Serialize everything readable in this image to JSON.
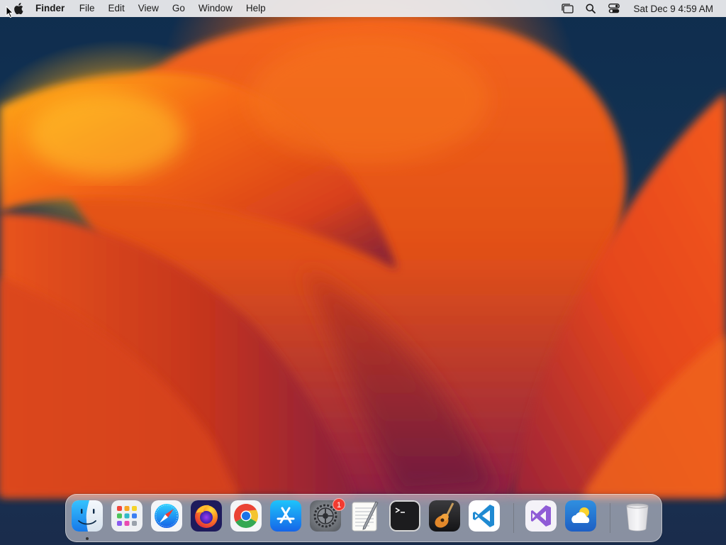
{
  "menubar": {
    "apple_icon": "apple-logo-icon",
    "app_name": "Finder",
    "menus": [
      "File",
      "Edit",
      "View",
      "Go",
      "Window",
      "Help"
    ],
    "status_icons": [
      "stage-manager-icon",
      "spotlight-search-icon",
      "control-center-icon"
    ],
    "clock": "Sat Dec 9  4:59 AM"
  },
  "dock": {
    "apps": [
      {
        "name": "Finder",
        "icon": "finder-icon",
        "running": true
      },
      {
        "name": "Launchpad",
        "icon": "launchpad-icon"
      },
      {
        "name": "Safari",
        "icon": "safari-icon"
      },
      {
        "name": "Firefox",
        "icon": "firefox-icon"
      },
      {
        "name": "Google Chrome",
        "icon": "chrome-icon"
      },
      {
        "name": "App Store",
        "icon": "app-store-icon"
      },
      {
        "name": "System Settings",
        "icon": "system-settings-icon",
        "badge": "1"
      },
      {
        "name": "TextEdit",
        "icon": "textedit-icon"
      },
      {
        "name": "Terminal",
        "icon": "terminal-icon"
      },
      {
        "name": "GarageBand",
        "icon": "garageband-icon"
      },
      {
        "name": "Visual Studio Code",
        "icon": "vscode-icon"
      }
    ],
    "recent_apps": [
      {
        "name": "Visual Studio",
        "icon": "visual-studio-icon"
      },
      {
        "name": "Weather",
        "icon": "weather-icon"
      }
    ],
    "trash": {
      "name": "Trash",
      "icon": "trash-icon"
    }
  },
  "colors": {
    "wallpaper_background": "#0f2d4e",
    "menubar": "#ececee",
    "badge": "#f23b30"
  }
}
